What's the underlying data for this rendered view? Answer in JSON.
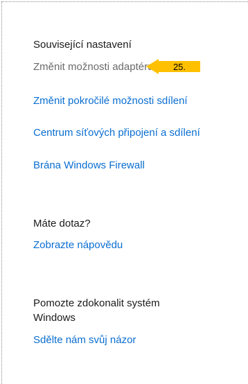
{
  "related_settings": {
    "heading": "Související nastavení",
    "items": [
      {
        "label": "Změnit možnosti adaptéru"
      },
      {
        "label": "Změnit pokročilé možnosti sdílení"
      },
      {
        "label": "Centrum síťových připojení a sdílení"
      },
      {
        "label": "Brána Windows Firewall"
      }
    ]
  },
  "callout": {
    "label": "25.",
    "color": "#ffc000"
  },
  "help": {
    "heading": "Máte dotaz?",
    "link": "Zobrazte nápovědu"
  },
  "feedback": {
    "heading_line1": "Pomozte zdokonalit systém",
    "heading_line2": "Windows",
    "link": "Sdělte nám svůj názor"
  },
  "colors": {
    "link": "#0a6ed1",
    "muted": "#6b6b6b",
    "text": "#1a1a1a"
  }
}
